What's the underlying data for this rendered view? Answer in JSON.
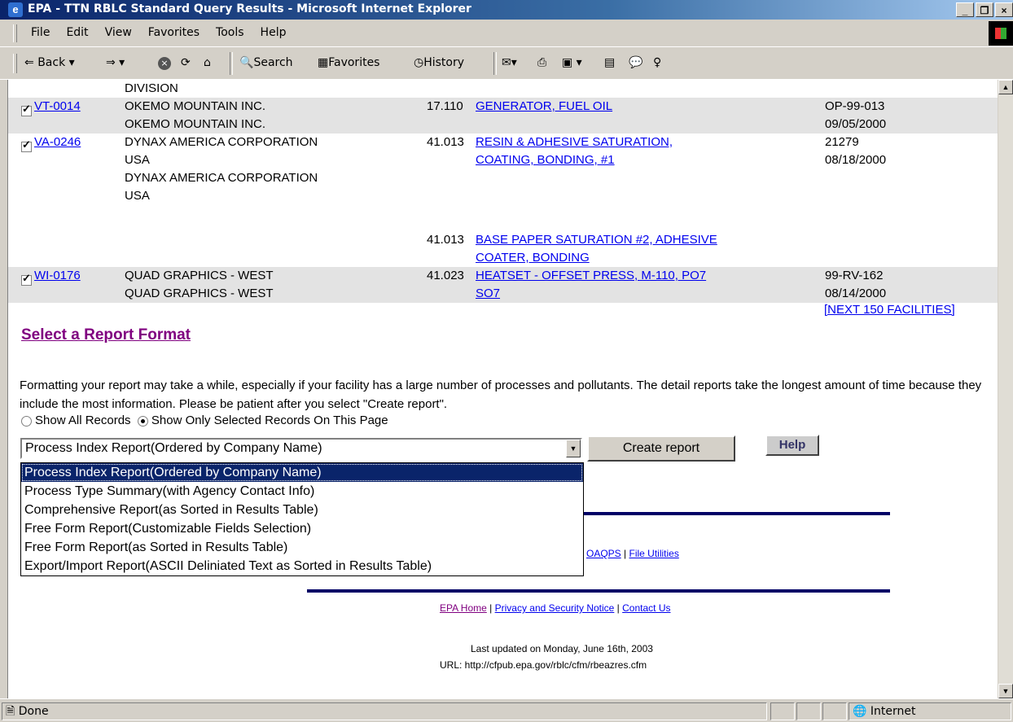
{
  "window": {
    "title": "EPA - TTN RBLC Standard Query Results - Microsoft Internet Explorer"
  },
  "menu": [
    "File",
    "Edit",
    "View",
    "Favorites",
    "Tools",
    "Help"
  ],
  "toolbar": {
    "back": "Back",
    "search": "Search",
    "favorites": "Favorites",
    "history": "History"
  },
  "table": {
    "rows": [
      {
        "id": "",
        "checked": false,
        "company": [
          "DIVISION"
        ],
        "code": "",
        "process": [],
        "permit": "",
        "date": "",
        "shaded": false
      },
      {
        "id": "VT-0014",
        "checked": true,
        "company": [
          "OKEMO MOUNTAIN INC.",
          "OKEMO MOUNTAIN INC."
        ],
        "code": "17.110",
        "process": [
          "GENERATOR, FUEL OIL"
        ],
        "permit": "OP-99-013",
        "date": "09/05/2000",
        "shaded": true
      },
      {
        "id": "VA-0246",
        "checked": true,
        "company": [
          "DYNAX AMERICA CORPORATION",
          "USA",
          "DYNAX AMERICA CORPORATION",
          "USA"
        ],
        "code": "41.013",
        "process": [
          "RESIN & ADHESIVE SATURATION,",
          "COATING, BONDING, #1"
        ],
        "permit": "21279",
        "date": "08/18/2000",
        "shaded": false
      },
      {
        "id": "",
        "checked": false,
        "company": [],
        "code": "41.013",
        "process": [
          "BASE PAPER SATURATION #2, ADHESIVE",
          "COATER, BONDING"
        ],
        "permit": "",
        "date": "",
        "shaded": false
      },
      {
        "id": "WI-0176",
        "checked": true,
        "company": [
          "QUAD GRAPHICS - WEST",
          "QUAD GRAPHICS - WEST"
        ],
        "code": "41.023",
        "process": [
          "HEATSET - OFFSET PRESS, M-110, PO7",
          "SO7"
        ],
        "permit": "99-RV-162",
        "date": "08/14/2000",
        "shaded": true
      }
    ],
    "next_link": "[NEXT 150 FACILITIES]"
  },
  "report": {
    "heading": "Select a Report Format",
    "description": "Formatting your report may take a while, especially if your facility has a large number of processes and pollutants. The detail reports take the longest amount of time because they include the most information. Please be patient after you select \"Create report\".",
    "radio_all": "Show All Records",
    "radio_selected": "Show Only Selected Records On This Page",
    "selected": "Process Index Report(Ordered by Company Name)",
    "options": [
      "Process Index Report(Ordered by Company Name)",
      "Process Type Summary(with Agency Contact Info)",
      "Comprehensive Report(as Sorted in Results Table)",
      "Free Form Report(Customizable Fields Selection)",
      "Free Form Report(as Sorted in Results Table)",
      "Export/Import Report(ASCII Deliniated Text as Sorted in Results Table)"
    ],
    "create_label": "Create report",
    "help_label": "Help"
  },
  "footer": {
    "link_oaqps": "OAQPS",
    "link_files": "File Utilities",
    "link_epa": "EPA Home",
    "link_privacy": "Privacy and Security Notice",
    "link_contact": "Contact Us",
    "updated": "Last updated on Monday, June 16th, 2003",
    "url": "URL: http://cfpub.epa.gov/rblc/cfm/rbeazres.cfm"
  },
  "status": {
    "text": "Done",
    "zone": "Internet"
  }
}
